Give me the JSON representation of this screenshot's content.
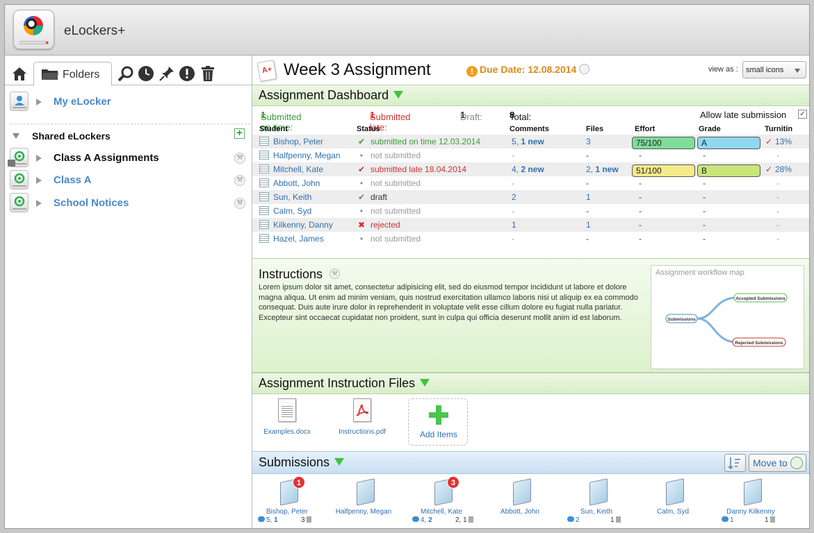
{
  "app": {
    "title": "eLockers+"
  },
  "left": {
    "folders_tab": "Folders",
    "my_elocker": "My eLocker",
    "shared_header": "Shared eLockers",
    "shared_items": [
      {
        "label": "Class A Assignments",
        "bold_black": true
      },
      {
        "label": "Class A",
        "bold_black": false
      },
      {
        "label": "School Notices",
        "bold_black": false
      }
    ]
  },
  "assignment": {
    "title": "Week 3 Assignment",
    "due": "Due Date: 12.08.2014",
    "view_as_label": "view as :",
    "view_as_value": "small icons"
  },
  "dashboard": {
    "title": "Assignment Dashboard",
    "submitted_on_time_label": "Submitted on time:",
    "submitted_on_time": "1",
    "submitted_late_label": "Submitted late:",
    "submitted_late": "1",
    "draft_label": "Draft:",
    "draft": "1",
    "total_label": "Total:",
    "total": "8",
    "allow_late": "Allow late submission",
    "allow_late_checked": true,
    "columns": [
      "Student",
      "Status",
      "Comments",
      "Files",
      "Effort",
      "Grade",
      "Turnitin"
    ],
    "rows": [
      {
        "student": "Bishop, Peter",
        "status_icon": "check",
        "status": "submitted on time 12.03.2014",
        "status_color": "#3a9a3a",
        "comments": "5, ",
        "comments_new": "1 new",
        "files": "3",
        "files_new": "",
        "effort": "75/100",
        "effort_color": "#7fdc9a",
        "grade": "A",
        "grade_color": "#8fd8f0",
        "turnitin": "13%"
      },
      {
        "student": "Halfpenny, Megan",
        "status_icon": "dot",
        "status": "not submitted",
        "status_color": "#999999",
        "comments": "-",
        "comments_new": "",
        "files": "-",
        "files_new": "",
        "effort": "-",
        "effort_color": "",
        "grade": "-",
        "grade_color": "",
        "turnitin": "-"
      },
      {
        "student": "Mitchell, Kate",
        "status_icon": "check-red",
        "status": "submitted late 18.04.2014",
        "status_color": "#d03030",
        "comments": "4, ",
        "comments_new": "2 new",
        "files": "2, ",
        "files_new": "1 new",
        "effort": "51/100",
        "effort_color": "#f4ea8c",
        "grade": "B",
        "grade_color": "#c9e67a",
        "turnitin": "28%"
      },
      {
        "student": "Abbott, John",
        "status_icon": "dot",
        "status": "not submitted",
        "status_color": "#999999",
        "comments": "-",
        "comments_new": "",
        "files": "-",
        "files_new": "",
        "effort": "-",
        "effort_color": "",
        "grade": "-",
        "grade_color": "",
        "turnitin": "-"
      },
      {
        "student": "Sun, Keith",
        "status_icon": "check-grey",
        "status": "draft",
        "status_color": "#333333",
        "comments": "2",
        "comments_new": "",
        "files": "1",
        "files_new": "",
        "effort": "-",
        "effort_color": "",
        "grade": "-",
        "grade_color": "",
        "turnitin": "-"
      },
      {
        "student": "Calm, Syd",
        "status_icon": "dot",
        "status": "not submitted",
        "status_color": "#999999",
        "comments": "-",
        "comments_new": "",
        "files": "-",
        "files_new": "",
        "effort": "-",
        "effort_color": "",
        "grade": "-",
        "grade_color": "",
        "turnitin": "-"
      },
      {
        "student": "Kilkenny, Danny",
        "status_icon": "cross",
        "status": "rejected",
        "status_color": "#d03030",
        "comments": "1",
        "comments_new": "",
        "files": "1",
        "files_new": "",
        "effort": "-",
        "effort_color": "",
        "grade": "-",
        "grade_color": "",
        "turnitin": "-"
      },
      {
        "student": "Hazel, James",
        "status_icon": "dot",
        "status": "not submitted",
        "status_color": "#999999",
        "comments": "-",
        "comments_new": "",
        "files": "-",
        "files_new": "",
        "effort": "-",
        "effort_color": "",
        "grade": "-",
        "grade_color": "",
        "turnitin": "-"
      }
    ]
  },
  "instructions": {
    "title": "Instructions",
    "text": "Lorem ipsum dolor sit amet, consectetur adipisicing elit, sed do eiusmod tempor incididunt ut labore et dolore magna aliqua. Ut enim ad minim veniam, quis nostrud exercitation ullamco laboris nisi ut aliquip ex ea commodo consequat. Duis aute irure dolor in reprehenderit in voluptate velit esse cillum dolore eu fugiat nulla pariatur. Excepteur sint occaecat cupidatat non proident, sunt in culpa qui officia deserunt mollit anim id est laborum.",
    "workflow_label": "Assignment workflow map",
    "workflow_nodes": [
      "Submissions",
      "Accepted Submissions",
      "Rejected Submissions"
    ]
  },
  "files": {
    "title": "Assignment Instruction Files",
    "items": [
      "Examples.docx",
      "Instructions.pdf"
    ],
    "add_label": "Add Items"
  },
  "submissions": {
    "title": "Submissions",
    "move_to": "Move to",
    "items": [
      {
        "name": "Bishop, Peter",
        "badge": "1",
        "comments": "5, ",
        "comments_new": "1",
        "files": "3"
      },
      {
        "name": "Halfpenny, Megan",
        "badge": "",
        "comments": "",
        "comments_new": "",
        "files": ""
      },
      {
        "name": "Mitchell, Kate",
        "badge": "3",
        "comments": "4, ",
        "comments_new": "2",
        "files": "2, 1"
      },
      {
        "name": "Abbott, John",
        "badge": "",
        "comments": "",
        "comments_new": "",
        "files": ""
      },
      {
        "name": "Sun, Keith",
        "badge": "",
        "comments": "2",
        "comments_new": "",
        "files": "1"
      },
      {
        "name": "Calm, Syd",
        "badge": "",
        "comments": "",
        "comments_new": "",
        "files": ""
      },
      {
        "name": "Danny Kilkenny",
        "badge": "",
        "comments": "1",
        "comments_new": "",
        "files": "1"
      }
    ]
  },
  "colors": {
    "accent_blue": "#2f6fb0",
    "header_green": "#d8eec8",
    "submissions_blue": "#c8dff2",
    "due_orange": "#d98a1a"
  }
}
